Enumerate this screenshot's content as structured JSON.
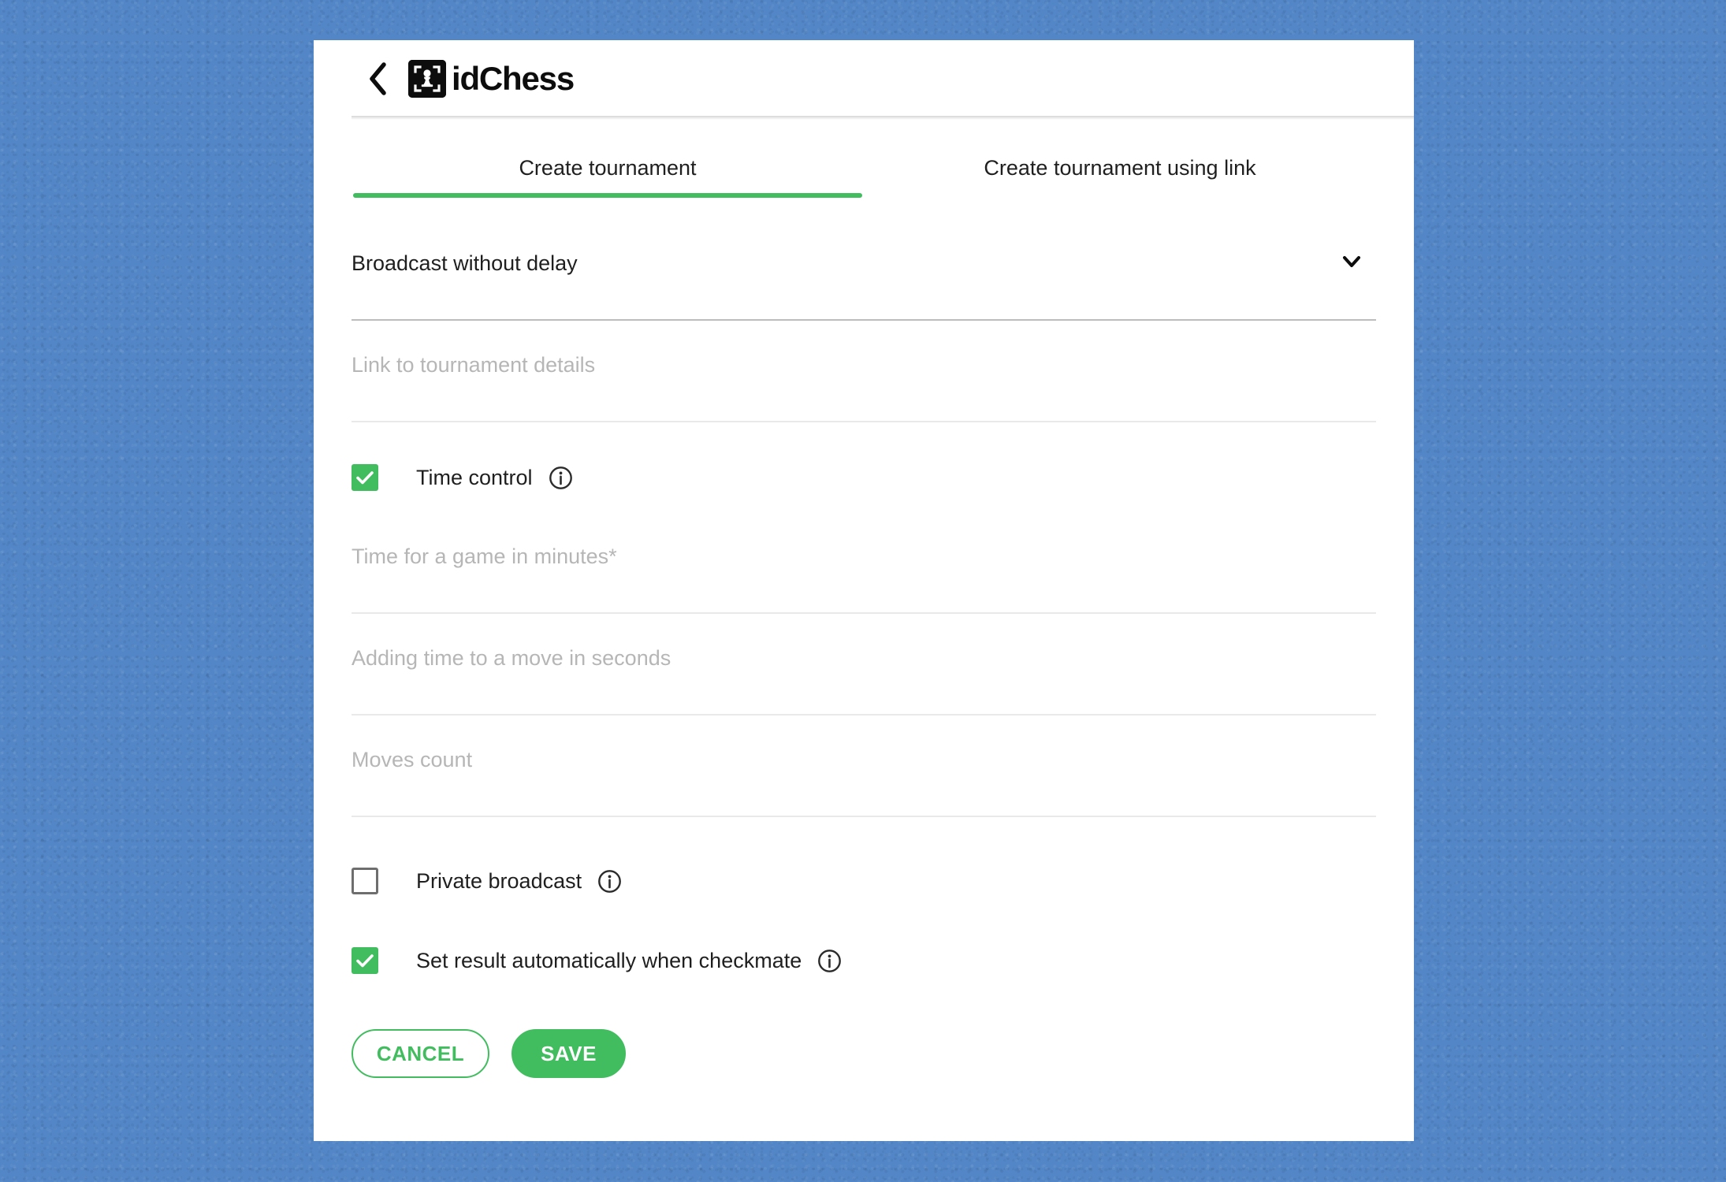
{
  "theme": {
    "accent_green": "#41bd5f",
    "background_blue": "#5286c6",
    "card_background": "#ffffff",
    "text_primary": "#1f1f1f",
    "placeholder_gray": "#b6b6b6"
  },
  "header": {
    "back_icon": "chevron-left-icon",
    "logo_icon": "idchess-pawn-logo-icon",
    "brand_name": "idChess"
  },
  "tabs": [
    {
      "label": "Create tournament",
      "active": true
    },
    {
      "label": "Create tournament using link",
      "active": false
    }
  ],
  "form": {
    "broadcast_delay": {
      "value": "Broadcast without delay",
      "chevron_icon": "chevron-down-icon"
    },
    "link_field": {
      "placeholder": "Link to tournament details",
      "value": ""
    },
    "time_control": {
      "label": "Time control",
      "checked": true,
      "info_icon": "info-circle-icon"
    },
    "time_for_game": {
      "placeholder": "Time for a game in minutes*",
      "value": ""
    },
    "adding_time": {
      "placeholder": "Adding time to a move in seconds",
      "value": ""
    },
    "moves_count": {
      "placeholder": "Moves count",
      "value": ""
    },
    "private_broadcast": {
      "label": "Private broadcast",
      "checked": false,
      "info_icon": "info-circle-icon"
    },
    "auto_result": {
      "label": "Set result automatically when checkmate",
      "checked": true,
      "info_icon": "info-circle-icon"
    }
  },
  "actions": {
    "cancel_label": "CANCEL",
    "save_label": "SAVE"
  }
}
